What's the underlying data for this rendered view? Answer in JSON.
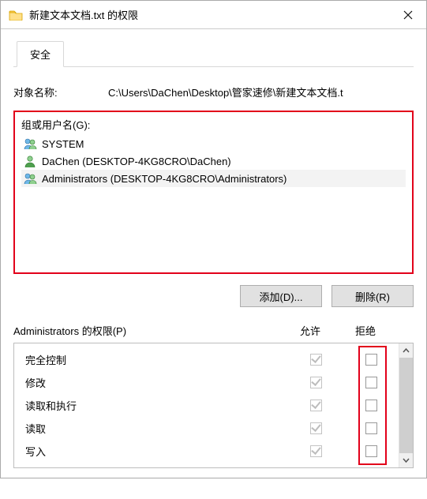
{
  "window": {
    "title": "新建文本文档.txt 的权限",
    "object_label": "对象名称:",
    "object_path": "C:\\Users\\DaChen\\Desktop\\管家速修\\新建文本文档.t"
  },
  "tabs": {
    "security": "安全"
  },
  "groups": {
    "label": "组或用户名(G):",
    "items": [
      {
        "name": "SYSTEM",
        "icon": "group",
        "selected": false
      },
      {
        "name": "DaChen (DESKTOP-4KG8CRO\\DaChen)",
        "icon": "user",
        "selected": false
      },
      {
        "name": "Administrators (DESKTOP-4KG8CRO\\Administrators)",
        "icon": "group",
        "selected": true
      }
    ]
  },
  "buttons": {
    "add": "添加(D)...",
    "remove": "删除(R)"
  },
  "permissions": {
    "header_label": "Administrators 的权限(P)",
    "col_allow": "允许",
    "col_deny": "拒绝",
    "rows": [
      {
        "name": "完全控制",
        "allow": true,
        "deny": false
      },
      {
        "name": "修改",
        "allow": true,
        "deny": false
      },
      {
        "name": "读取和执行",
        "allow": true,
        "deny": false
      },
      {
        "name": "读取",
        "allow": true,
        "deny": false
      },
      {
        "name": "写入",
        "allow": true,
        "deny": false
      }
    ]
  },
  "colors": {
    "highlight": "#e2001a"
  }
}
